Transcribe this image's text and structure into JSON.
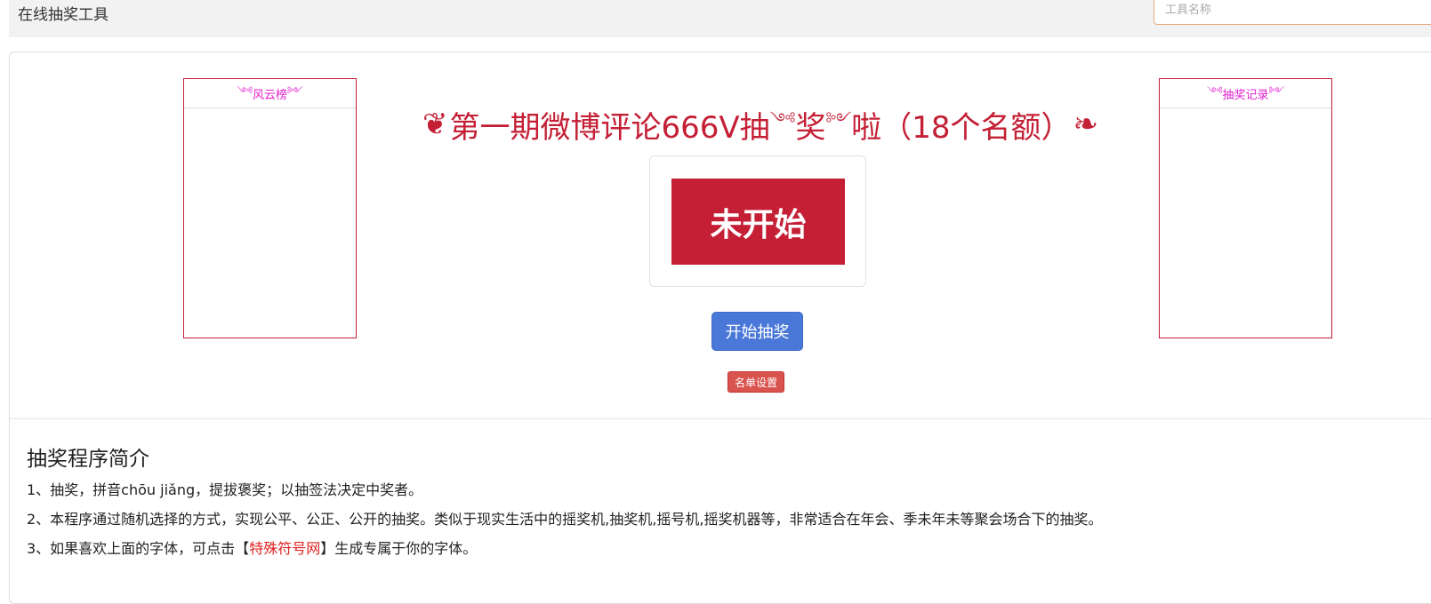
{
  "header": {
    "title": "在线抽奖工具",
    "search_placeholder": "工具名称"
  },
  "leaderboard": {
    "title": "风云榜",
    "ornament_left": "༺",
    "ornament_right": "༻"
  },
  "records": {
    "title": "抽奖记录",
    "ornament_left": "༺",
    "ornament_right": "༻"
  },
  "lottery": {
    "title_part1": "第一期微博评论666V抽",
    "title_mid_ornament": "༺",
    "title_part2": "奖",
    "title_mid_ornament2": "༻",
    "title_part3": "啦（18个名额）",
    "flourish_left": "❦",
    "flourish_right": "❧",
    "status": "未开始",
    "start_button": "开始抽奖",
    "list_button": "名单设置"
  },
  "intro": {
    "heading": "抽奖程序简介",
    "line1": "1、抽奖，拼音chōu jiǎng，提拔褒奖；以抽签法决定中奖者。",
    "line2": "2、本程序通过随机选择的方式，实现公平、公正、公开的抽奖。类似于现实生活中的摇奖机,抽奖机,摇号机,摇奖机器等，非常适合在年会、季未年未等聚会场合下的抽奖。",
    "line3_prefix": "3、如果喜欢上面的字体，可点击【",
    "line3_link": "特殊符号网",
    "line3_suffix": "】生成专属于你的字体。"
  },
  "colors": {
    "accent_red": "#c41f35",
    "magenta": "#e020d0",
    "primary_blue": "#4a78d8",
    "danger_red": "#d9534f"
  }
}
